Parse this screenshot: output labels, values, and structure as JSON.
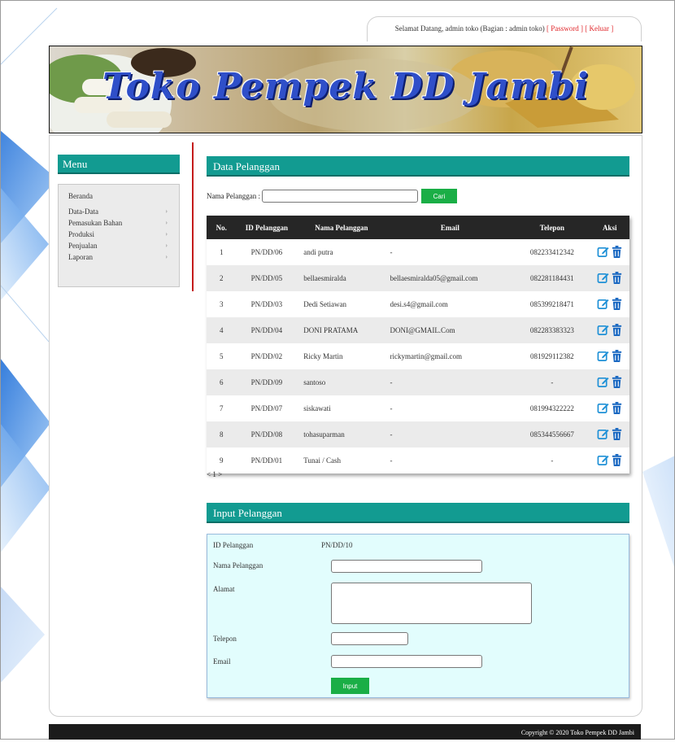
{
  "header": {
    "welcome_text": "Selamat Datang, admin toko (Bagian : admin toko)",
    "password_link": "[ Password ]",
    "logout_link": "[ Keluar ]",
    "site_title": "Toko Pempek DD Jambi"
  },
  "menu": {
    "title": "Menu",
    "items": [
      {
        "label": "Beranda"
      },
      {
        "label": "Data-Data"
      },
      {
        "label": "Pemasukan Bahan"
      },
      {
        "label": "Produksi"
      },
      {
        "label": "Penjualan"
      },
      {
        "label": "Laporan"
      }
    ]
  },
  "data_section": {
    "title": "Data Pelanggan",
    "search_label": "Nama Pelanggan :",
    "search_value": "",
    "search_button": "Cari",
    "columns": [
      "No.",
      "ID Pelanggan",
      "Nama Pelanggan",
      "Email",
      "Telepon",
      "Aksi"
    ],
    "rows": [
      {
        "no": "1",
        "id": "PN/DD/06",
        "nama": "andi putra",
        "email": "-",
        "telepon": "082233412342"
      },
      {
        "no": "2",
        "id": "PN/DD/05",
        "nama": "bellaesmiralda",
        "email": "bellaesmiralda05@gmail.com",
        "telepon": "082281184431"
      },
      {
        "no": "3",
        "id": "PN/DD/03",
        "nama": "Dedi Setiawan",
        "email": "desi.s4@gmail.com",
        "telepon": "085399218471"
      },
      {
        "no": "4",
        "id": "PN/DD/04",
        "nama": "DONI PRATAMA",
        "email": "DONI@GMAIL.Com",
        "telepon": "082283383323"
      },
      {
        "no": "5",
        "id": "PN/DD/02",
        "nama": "Ricky Martin",
        "email": "rickymartin@gmail.com",
        "telepon": "081929112382"
      },
      {
        "no": "6",
        "id": "PN/DD/09",
        "nama": "santoso",
        "email": "-",
        "telepon": "-"
      },
      {
        "no": "7",
        "id": "PN/DD/07",
        "nama": "siskawati",
        "email": "-",
        "telepon": "081994322222"
      },
      {
        "no": "8",
        "id": "PN/DD/08",
        "nama": "tohasuparman",
        "email": "-",
        "telepon": "085344556667"
      },
      {
        "no": "9",
        "id": "PN/DD/01",
        "nama": "Tunai / Cash",
        "email": "-",
        "telepon": "-"
      }
    ],
    "pagination": "< 1 >"
  },
  "input_section": {
    "title": "Input Pelanggan",
    "id_label": "ID Pelanggan",
    "id_value": "PN/DD/10",
    "nama_label": "Nama Pelanggan",
    "alamat_label": "Alamat",
    "telepon_label": "Telepon",
    "email_label": "Email",
    "submit_button": "Input"
  },
  "footer": {
    "copyright": "Copyright © 2020 Toko Pempek DD Jambi"
  },
  "colors": {
    "accent_teal": "#129b91",
    "button_green": "#1aae46",
    "link_red": "#e0262a",
    "edit_icon_blue": "#1e90d6",
    "delete_icon_blue": "#1565c0"
  }
}
